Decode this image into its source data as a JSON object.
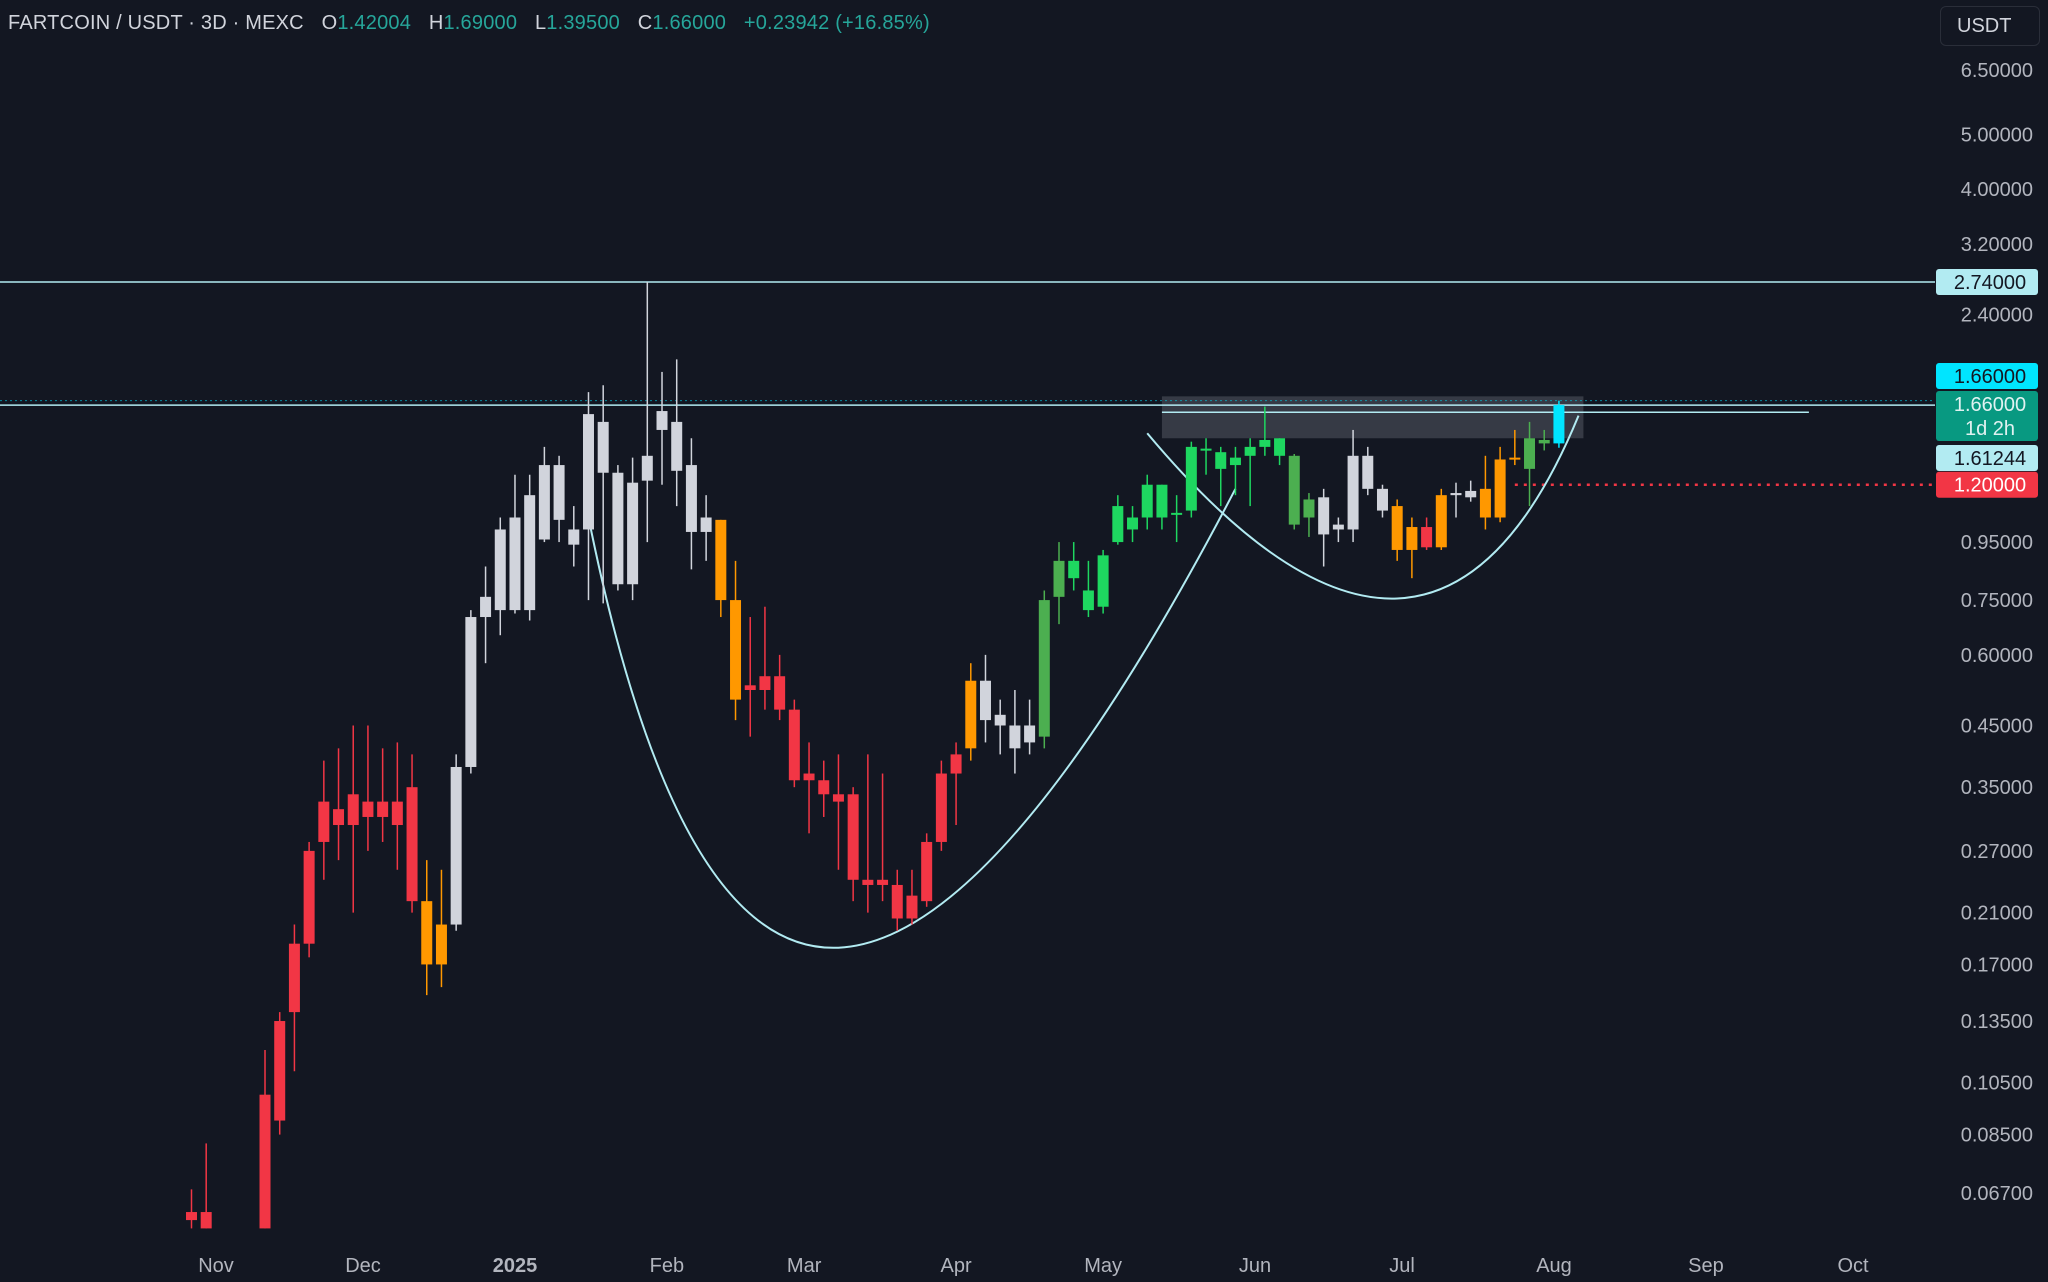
{
  "header": {
    "symbol": "FARTCOIN / USDT · 3D · MEXC",
    "open_label": "O",
    "open": "1.42004",
    "high_label": "H",
    "high": "1.69000",
    "low_label": "L",
    "low": "1.39500",
    "close_label": "C",
    "close": "1.66000",
    "change": "+0.23942 (+16.85%)"
  },
  "currency": "USDT",
  "colors": {
    "background": "#131722",
    "text": "#b2b5be",
    "up_green": "#26a69a",
    "bright_green": "#1ed760",
    "dark_green": "#4caf50",
    "red": "#f23645",
    "orange": "#ff9800",
    "gray_candle": "#d1d4dc",
    "cyan": "#00e5ff",
    "line": "#b2ebf2",
    "stop_red": "#f23645"
  },
  "chart_data": {
    "type": "candlestick",
    "y_scale": "log",
    "ylim": [
      0.0555,
      7.6
    ],
    "y_ticks": [
      "6.50000",
      "5.00000",
      "4.00000",
      "3.20000",
      "2.40000",
      "0.95000",
      "0.75000",
      "0.60000",
      "0.45000",
      "0.35000",
      "0.27000",
      "0.21000",
      "0.17000",
      "0.13500",
      "0.10500",
      "0.08500",
      "0.06700"
    ],
    "x_ticks": [
      {
        "label": "Nov",
        "date": "2024-11-01",
        "bold": false
      },
      {
        "label": "Dec",
        "date": "2024-12-01",
        "bold": false
      },
      {
        "label": "2025",
        "date": "2025-01-01",
        "bold": true
      },
      {
        "label": "Feb",
        "date": "2025-02-01",
        "bold": false
      },
      {
        "label": "Mar",
        "date": "2025-03-01",
        "bold": false
      },
      {
        "label": "Apr",
        "date": "2025-04-01",
        "bold": false
      },
      {
        "label": "May",
        "date": "2025-05-01",
        "bold": false
      },
      {
        "label": "Jun",
        "date": "2025-06-01",
        "bold": false
      },
      {
        "label": "Jul",
        "date": "2025-07-01",
        "bold": false
      },
      {
        "label": "Aug",
        "date": "2025-08-01",
        "bold": false
      },
      {
        "label": "Sep",
        "date": "2025-09-01",
        "bold": false
      },
      {
        "label": "Oct",
        "date": "2025-10-01",
        "bold": false
      }
    ],
    "candles": [
      {
        "date": "2024-10-27",
        "o": 0.06,
        "h": 0.068,
        "l": 0.058,
        "c": 0.062,
        "color": "red"
      },
      {
        "date": "2024-10-30",
        "o": 0.062,
        "h": 0.082,
        "l": 0.058,
        "c": 0.058,
        "color": "red"
      },
      {
        "date": "2024-11-11",
        "o": 0.058,
        "h": 0.12,
        "l": 0.058,
        "c": 0.1,
        "color": "red"
      },
      {
        "date": "2024-11-14",
        "o": 0.09,
        "h": 0.14,
        "l": 0.085,
        "c": 0.135,
        "color": "red"
      },
      {
        "date": "2024-11-17",
        "o": 0.14,
        "h": 0.2,
        "l": 0.11,
        "c": 0.185,
        "color": "red"
      },
      {
        "date": "2024-11-20",
        "o": 0.185,
        "h": 0.28,
        "l": 0.175,
        "c": 0.27,
        "color": "red"
      },
      {
        "date": "2024-11-23",
        "o": 0.28,
        "h": 0.39,
        "l": 0.24,
        "c": 0.33,
        "color": "red"
      },
      {
        "date": "2024-11-26",
        "o": 0.32,
        "h": 0.41,
        "l": 0.26,
        "c": 0.3,
        "color": "red"
      },
      {
        "date": "2024-11-29",
        "o": 0.34,
        "h": 0.45,
        "l": 0.21,
        "c": 0.3,
        "color": "red"
      },
      {
        "date": "2024-12-02",
        "o": 0.33,
        "h": 0.45,
        "l": 0.27,
        "c": 0.31,
        "color": "red"
      },
      {
        "date": "2024-12-05",
        "o": 0.31,
        "h": 0.41,
        "l": 0.28,
        "c": 0.33,
        "color": "red"
      },
      {
        "date": "2024-12-08",
        "o": 0.33,
        "h": 0.42,
        "l": 0.25,
        "c": 0.3,
        "color": "red"
      },
      {
        "date": "2024-12-11",
        "o": 0.35,
        "h": 0.4,
        "l": 0.21,
        "c": 0.22,
        "color": "red"
      },
      {
        "date": "2024-12-14",
        "o": 0.22,
        "h": 0.26,
        "l": 0.15,
        "c": 0.17,
        "color": "orange"
      },
      {
        "date": "2024-12-17",
        "o": 0.17,
        "h": 0.25,
        "l": 0.155,
        "c": 0.2,
        "color": "orange"
      },
      {
        "date": "2024-12-20",
        "o": 0.2,
        "h": 0.4,
        "l": 0.195,
        "c": 0.38,
        "color": "gray"
      },
      {
        "date": "2024-12-23",
        "o": 0.38,
        "h": 0.72,
        "l": 0.37,
        "c": 0.7,
        "color": "gray"
      },
      {
        "date": "2024-12-26",
        "o": 0.7,
        "h": 0.86,
        "l": 0.58,
        "c": 0.76,
        "color": "gray"
      },
      {
        "date": "2024-12-29",
        "o": 0.72,
        "h": 1.05,
        "l": 0.65,
        "c": 1.0,
        "color": "gray"
      },
      {
        "date": "2025-01-01",
        "o": 0.72,
        "h": 1.25,
        "l": 0.71,
        "c": 1.05,
        "color": "gray"
      },
      {
        "date": "2025-01-04",
        "o": 1.15,
        "h": 1.25,
        "l": 0.69,
        "c": 0.72,
        "color": "gray"
      },
      {
        "date": "2025-01-07",
        "o": 0.96,
        "h": 1.4,
        "l": 0.95,
        "c": 1.3,
        "color": "gray"
      },
      {
        "date": "2025-01-10",
        "o": 1.3,
        "h": 1.35,
        "l": 0.95,
        "c": 1.04,
        "color": "gray"
      },
      {
        "date": "2025-01-13",
        "o": 1.0,
        "h": 1.1,
        "l": 0.86,
        "c": 0.94,
        "color": "gray"
      },
      {
        "date": "2025-01-16",
        "o": 1.0,
        "h": 1.75,
        "l": 0.75,
        "c": 1.6,
        "color": "gray"
      },
      {
        "date": "2025-01-19",
        "o": 1.55,
        "h": 1.8,
        "l": 0.74,
        "c": 1.26,
        "color": "gray"
      },
      {
        "date": "2025-01-22",
        "o": 1.26,
        "h": 1.3,
        "l": 0.78,
        "c": 0.8,
        "color": "gray"
      },
      {
        "date": "2025-01-25",
        "o": 0.8,
        "h": 1.34,
        "l": 0.75,
        "c": 1.21,
        "color": "gray"
      },
      {
        "date": "2025-01-28",
        "o": 1.22,
        "h": 2.74,
        "l": 0.95,
        "c": 1.35,
        "color": "gray"
      },
      {
        "date": "2025-01-31",
        "o": 1.62,
        "h": 1.9,
        "l": 1.2,
        "c": 1.5,
        "color": "gray"
      },
      {
        "date": "2025-02-03",
        "o": 1.55,
        "h": 2.0,
        "l": 1.1,
        "c": 1.27,
        "color": "gray"
      },
      {
        "date": "2025-02-06",
        "o": 1.3,
        "h": 1.45,
        "l": 0.85,
        "c": 0.99,
        "color": "gray"
      },
      {
        "date": "2025-02-09",
        "o": 1.05,
        "h": 1.15,
        "l": 0.88,
        "c": 0.99,
        "color": "gray"
      },
      {
        "date": "2025-02-12",
        "o": 1.04,
        "h": 1.04,
        "l": 0.7,
        "c": 0.75,
        "color": "orange"
      },
      {
        "date": "2025-02-15",
        "o": 0.75,
        "h": 0.88,
        "l": 0.46,
        "c": 0.5,
        "color": "orange"
      },
      {
        "date": "2025-02-18",
        "o": 0.53,
        "h": 0.7,
        "l": 0.43,
        "c": 0.52,
        "color": "red"
      },
      {
        "date": "2025-02-21",
        "o": 0.52,
        "h": 0.73,
        "l": 0.48,
        "c": 0.55,
        "color": "red"
      },
      {
        "date": "2025-02-24",
        "o": 0.55,
        "h": 0.6,
        "l": 0.46,
        "c": 0.48,
        "color": "red"
      },
      {
        "date": "2025-02-27",
        "o": 0.48,
        "h": 0.5,
        "l": 0.35,
        "c": 0.36,
        "color": "red"
      },
      {
        "date": "2025-03-02",
        "o": 0.37,
        "h": 0.42,
        "l": 0.29,
        "c": 0.36,
        "color": "red"
      },
      {
        "date": "2025-03-05",
        "o": 0.36,
        "h": 0.39,
        "l": 0.31,
        "c": 0.34,
        "color": "red"
      },
      {
        "date": "2025-03-08",
        "o": 0.34,
        "h": 0.4,
        "l": 0.25,
        "c": 0.33,
        "color": "red"
      },
      {
        "date": "2025-03-11",
        "o": 0.34,
        "h": 0.35,
        "l": 0.22,
        "c": 0.24,
        "color": "red"
      },
      {
        "date": "2025-03-14",
        "o": 0.24,
        "h": 0.4,
        "l": 0.21,
        "c": 0.235,
        "color": "red"
      },
      {
        "date": "2025-03-17",
        "o": 0.24,
        "h": 0.37,
        "l": 0.22,
        "c": 0.235,
        "color": "red"
      },
      {
        "date": "2025-03-20",
        "o": 0.235,
        "h": 0.25,
        "l": 0.195,
        "c": 0.205,
        "color": "red"
      },
      {
        "date": "2025-03-23",
        "o": 0.225,
        "h": 0.25,
        "l": 0.2,
        "c": 0.205,
        "color": "red"
      },
      {
        "date": "2025-03-26",
        "o": 0.22,
        "h": 0.29,
        "l": 0.215,
        "c": 0.28,
        "color": "red"
      },
      {
        "date": "2025-03-29",
        "o": 0.28,
        "h": 0.39,
        "l": 0.27,
        "c": 0.37,
        "color": "red"
      },
      {
        "date": "2025-04-01",
        "o": 0.37,
        "h": 0.42,
        "l": 0.3,
        "c": 0.4,
        "color": "red"
      },
      {
        "date": "2025-04-04",
        "o": 0.41,
        "h": 0.58,
        "l": 0.39,
        "c": 0.54,
        "color": "orange"
      },
      {
        "date": "2025-04-07",
        "o": 0.54,
        "h": 0.6,
        "l": 0.42,
        "c": 0.46,
        "color": "gray"
      },
      {
        "date": "2025-04-10",
        "o": 0.47,
        "h": 0.5,
        "l": 0.4,
        "c": 0.45,
        "color": "gray"
      },
      {
        "date": "2025-04-13",
        "o": 0.45,
        "h": 0.52,
        "l": 0.37,
        "c": 0.41,
        "color": "gray"
      },
      {
        "date": "2025-04-16",
        "o": 0.45,
        "h": 0.5,
        "l": 0.4,
        "c": 0.42,
        "color": "gray"
      },
      {
        "date": "2025-04-19",
        "o": 0.43,
        "h": 0.78,
        "l": 0.41,
        "c": 0.75,
        "color": "dkgreen"
      },
      {
        "date": "2025-04-22",
        "o": 0.76,
        "h": 0.95,
        "l": 0.68,
        "c": 0.88,
        "color": "dkgreen"
      },
      {
        "date": "2025-04-25",
        "o": 0.82,
        "h": 0.95,
        "l": 0.78,
        "c": 0.88,
        "color": "green"
      },
      {
        "date": "2025-04-28",
        "o": 0.78,
        "h": 0.88,
        "l": 0.7,
        "c": 0.72,
        "color": "green"
      },
      {
        "date": "2025-05-01",
        "o": 0.73,
        "h": 0.92,
        "l": 0.71,
        "c": 0.9,
        "color": "green"
      },
      {
        "date": "2025-05-04",
        "o": 0.95,
        "h": 1.15,
        "l": 0.94,
        "c": 1.1,
        "color": "green"
      },
      {
        "date": "2025-05-07",
        "o": 1.0,
        "h": 1.1,
        "l": 0.95,
        "c": 1.05,
        "color": "green"
      },
      {
        "date": "2025-05-10",
        "o": 1.05,
        "h": 1.25,
        "l": 1.0,
        "c": 1.2,
        "color": "green"
      },
      {
        "date": "2025-05-13",
        "o": 1.05,
        "h": 1.2,
        "l": 1.0,
        "c": 1.2,
        "color": "green"
      },
      {
        "date": "2025-05-16",
        "o": 1.07,
        "h": 1.15,
        "l": 0.95,
        "c": 1.07,
        "color": "green"
      },
      {
        "date": "2025-05-19",
        "o": 1.08,
        "h": 1.43,
        "l": 1.05,
        "c": 1.4,
        "color": "green"
      },
      {
        "date": "2025-05-22",
        "o": 1.38,
        "h": 1.45,
        "l": 1.25,
        "c": 1.39,
        "color": "green"
      },
      {
        "date": "2025-05-25",
        "o": 1.28,
        "h": 1.4,
        "l": 1.1,
        "c": 1.37,
        "color": "green"
      },
      {
        "date": "2025-05-28",
        "o": 1.3,
        "h": 1.4,
        "l": 1.15,
        "c": 1.34,
        "color": "green"
      },
      {
        "date": "2025-05-31",
        "o": 1.35,
        "h": 1.45,
        "l": 1.1,
        "c": 1.4,
        "color": "green"
      },
      {
        "date": "2025-06-03",
        "o": 1.4,
        "h": 1.65,
        "l": 1.35,
        "c": 1.44,
        "color": "green"
      },
      {
        "date": "2025-06-06",
        "o": 1.45,
        "h": 1.45,
        "l": 1.3,
        "c": 1.35,
        "color": "green"
      },
      {
        "date": "2025-06-09",
        "o": 1.35,
        "h": 1.36,
        "l": 1.0,
        "c": 1.02,
        "color": "dkgreen"
      },
      {
        "date": "2025-06-12",
        "o": 1.05,
        "h": 1.16,
        "l": 0.97,
        "c": 1.13,
        "color": "dkgreen"
      },
      {
        "date": "2025-06-15",
        "o": 1.14,
        "h": 1.18,
        "l": 0.86,
        "c": 0.98,
        "color": "gray"
      },
      {
        "date": "2025-06-18",
        "o": 1.0,
        "h": 1.05,
        "l": 0.95,
        "c": 1.02,
        "color": "gray"
      },
      {
        "date": "2025-06-21",
        "o": 1.0,
        "h": 1.5,
        "l": 0.95,
        "c": 1.35,
        "color": "gray"
      },
      {
        "date": "2025-06-24",
        "o": 1.35,
        "h": 1.4,
        "l": 1.15,
        "c": 1.18,
        "color": "gray"
      },
      {
        "date": "2025-06-27",
        "o": 1.18,
        "h": 1.2,
        "l": 1.05,
        "c": 1.08,
        "color": "gray"
      },
      {
        "date": "2025-06-30",
        "o": 1.1,
        "h": 1.13,
        "l": 0.88,
        "c": 0.92,
        "color": "orange"
      },
      {
        "date": "2025-07-03",
        "o": 0.92,
        "h": 1.05,
        "l": 0.82,
        "c": 1.01,
        "color": "orange"
      },
      {
        "date": "2025-07-06",
        "o": 1.01,
        "h": 1.05,
        "l": 0.92,
        "c": 0.93,
        "color": "red"
      },
      {
        "date": "2025-07-09",
        "o": 0.93,
        "h": 1.18,
        "l": 0.92,
        "c": 1.15,
        "color": "orange"
      },
      {
        "date": "2025-07-12",
        "o": 1.15,
        "h": 1.21,
        "l": 1.05,
        "c": 1.16,
        "color": "gray"
      },
      {
        "date": "2025-07-15",
        "o": 1.14,
        "h": 1.22,
        "l": 1.12,
        "c": 1.17,
        "color": "gray"
      },
      {
        "date": "2025-07-18",
        "o": 1.18,
        "h": 1.35,
        "l": 1.0,
        "c": 1.05,
        "color": "orange"
      },
      {
        "date": "2025-07-21",
        "o": 1.05,
        "h": 1.4,
        "l": 1.03,
        "c": 1.33,
        "color": "orange"
      },
      {
        "date": "2025-07-24",
        "o": 1.34,
        "h": 1.5,
        "l": 1.3,
        "c": 1.34,
        "color": "orange"
      },
      {
        "date": "2025-07-27",
        "o": 1.28,
        "h": 1.55,
        "l": 1.1,
        "c": 1.45,
        "color": "dkgreen"
      },
      {
        "date": "2025-07-30",
        "o": 1.42,
        "h": 1.5,
        "l": 1.38,
        "c": 1.44,
        "color": "dkgreen"
      },
      {
        "date": "2025-08-02",
        "o": 1.42,
        "h": 1.69,
        "l": 1.395,
        "c": 1.66,
        "color": "cyan"
      }
    ],
    "levels": [
      {
        "value": 2.74,
        "label": "2.74000",
        "style": "solid"
      },
      {
        "value": 1.66,
        "label": "1.66000",
        "style": "solid"
      },
      {
        "value": 1.61244,
        "label": "1.61244",
        "style": "solid_short"
      },
      {
        "value": 1.2,
        "label": "1.20000",
        "style": "dotted_red"
      }
    ],
    "price_labels": {
      "last_price": "1.66000",
      "countdown_price": "1.66000",
      "countdown": "1d 2h",
      "level_1": "1.61244",
      "stop": "1.20000",
      "ath": "2.74000"
    },
    "resistance_zone": {
      "from_date": "2025-05-13",
      "to_date": "2025-08-07",
      "low": 1.45,
      "high": 1.72
    },
    "cup_curve": [
      {
        "date": "2025-01-16",
        "price": 1.05
      },
      {
        "date": "2025-03-08",
        "price": 0.182
      },
      {
        "date": "2025-05-28",
        "price": 1.18
      }
    ],
    "handle_curve": [
      {
        "date": "2025-05-10",
        "price": 1.48
      },
      {
        "date": "2025-06-30",
        "price": 0.755
      },
      {
        "date": "2025-08-06",
        "price": 1.59
      }
    ]
  }
}
